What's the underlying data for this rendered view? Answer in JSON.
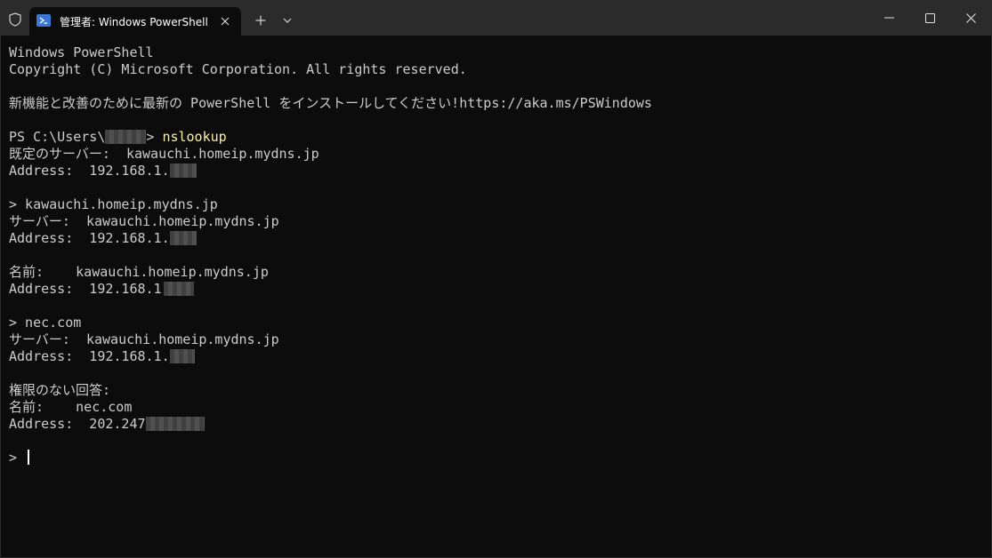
{
  "window": {
    "tab_title": "管理者: Windows PowerShell",
    "tab_icon": "powershell-icon",
    "icons": [
      "shield-icon",
      "close-icon",
      "plus-icon",
      "chevron-down-icon",
      "minimize-icon",
      "maximize-icon",
      "close-window-icon"
    ]
  },
  "terminal": {
    "l1": "Windows PowerShell",
    "l2": "Copyright (C) Microsoft Corporation. All rights reserved.",
    "l4": "新機能と改善のために最新の PowerShell をインストールしてください!https://aka.ms/PSWindows",
    "l6_prompt": "PS C:\\Users\\",
    "l6_prompt_end": "> ",
    "l6_cmd": "nslookup",
    "l7": "既定のサーバー:  kawauchi.homeip.mydns.jp",
    "l8": "Address:  192.168.1.",
    "l10": "> kawauchi.homeip.mydns.jp",
    "l11": "サーバー:  kawauchi.homeip.mydns.jp",
    "l12": "Address:  192.168.1.",
    "l14": "名前:    kawauchi.homeip.mydns.jp",
    "l15": "Address:  192.168.1",
    "l17": "> nec.com",
    "l18": "サーバー:  kawauchi.homeip.mydns.jp",
    "l19": "Address:  192.168.1.",
    "l21": "権限のない回答:",
    "l22": "名前:    nec.com",
    "l23": "Address:  202.247",
    "l25": "> "
  },
  "colors": {
    "background": "#0c0c0c",
    "titlebar": "#2b2b2b",
    "text": "#cccccc",
    "command": "#f9f1a5"
  }
}
